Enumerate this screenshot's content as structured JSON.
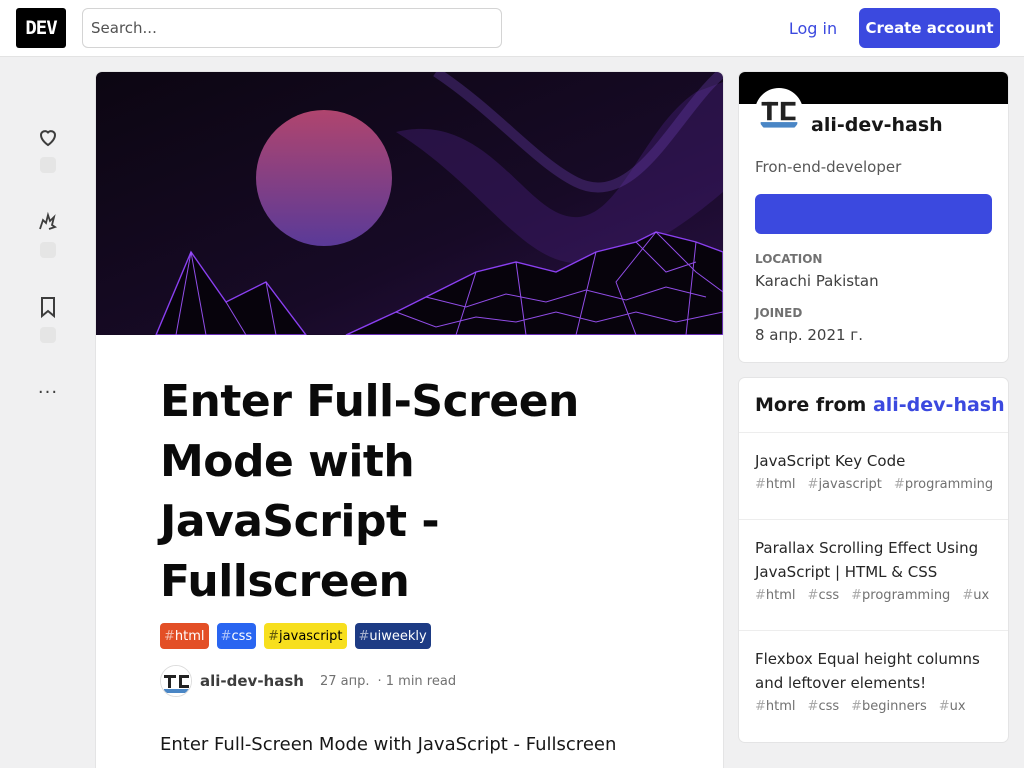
{
  "header": {
    "logo": "DEV",
    "search_placeholder": "Search...",
    "login_label": "Log in",
    "create_label": "Create account"
  },
  "reactions": {
    "more": "···"
  },
  "article": {
    "title": "Enter Full-Screen Mode with JavaScript - Fullscreen",
    "tags": [
      {
        "name": "html",
        "bg": "#e34f26",
        "fg": "#ffffff"
      },
      {
        "name": "css",
        "bg": "#2965f1",
        "fg": "#ffffff"
      },
      {
        "name": "javascript",
        "bg": "#f7df1e",
        "fg": "#000000"
      },
      {
        "name": "uiweekly",
        "bg": "#1d3b84",
        "fg": "#ffffff"
      }
    ],
    "author": "ali-dev-hash",
    "date": "27 апр.",
    "read_time": "· 1 min read",
    "body_first_line": "Enter Full-Screen Mode with JavaScript - Fullscreen"
  },
  "profile": {
    "name": "ali-dev-hash",
    "bio": "Fron-end-developer",
    "location_label": "LOCATION",
    "location": "Karachi Pakistan",
    "joined_label": "JOINED",
    "joined": "8 апр. 2021 г."
  },
  "more_from": {
    "prefix": "More from",
    "author": "ali-dev-hash",
    "items": [
      {
        "title": "JavaScript Key Code",
        "tags": [
          "html",
          "javascript",
          "programming"
        ]
      },
      {
        "title": "Parallax Scrolling Effect Using JavaScript | HTML & CSS",
        "tags": [
          "html",
          "css",
          "programming",
          "ux"
        ]
      },
      {
        "title": "Flexbox Equal height columns and leftover elements!",
        "tags": [
          "html",
          "css",
          "beginners",
          "ux"
        ]
      }
    ]
  },
  "colors": {
    "accent": "#3b49df",
    "cover_bg": "#0d0714",
    "cover_grid": "#8a3ff0"
  }
}
